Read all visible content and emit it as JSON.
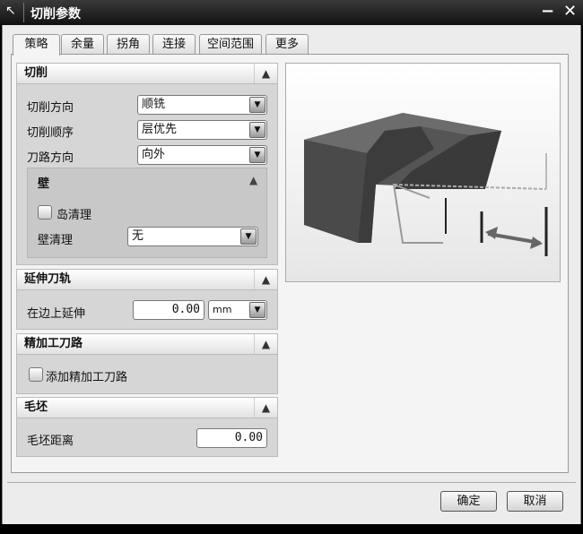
{
  "window": {
    "title": "切削参数"
  },
  "tabs": [
    {
      "label": "策略"
    },
    {
      "label": "余量"
    },
    {
      "label": "拐角"
    },
    {
      "label": "连接"
    },
    {
      "label": "空间范围"
    },
    {
      "label": "更多"
    }
  ],
  "cut": {
    "header": "切削",
    "direction_label": "切削方向",
    "direction_value": "顺铣",
    "order_label": "切削顺序",
    "order_value": "层优先",
    "path_label": "刀路方向",
    "path_value": "向外",
    "wall": {
      "header": "壁",
      "island_label": "岛清理",
      "island_checked": false,
      "wall_clean_label": "壁清理",
      "wall_clean_value": "无"
    }
  },
  "extend": {
    "header": "延伸刀轨",
    "edge_label": "在边上延伸",
    "edge_value": "0.00",
    "unit": "mm"
  },
  "finish": {
    "header": "精加工刀路",
    "add_label": "添加精加工刀路",
    "add_checked": false
  },
  "blank": {
    "header": "毛坯",
    "distance_label": "毛坯距离",
    "distance_value": "0.00"
  },
  "buttons": {
    "ok": "确定",
    "cancel": "取消"
  }
}
